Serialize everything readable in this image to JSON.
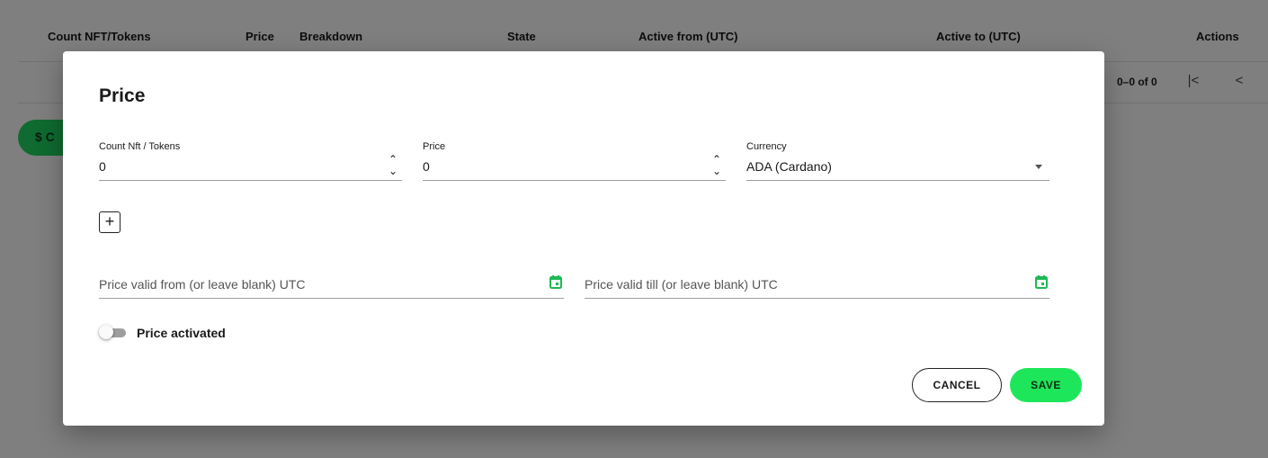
{
  "table": {
    "columns": [
      "Count NFT/Tokens",
      "Price",
      "Breakdown",
      "State",
      "Active from (UTC)",
      "Active to (UTC)",
      "Actions"
    ],
    "pagination": "0–0 of 0"
  },
  "background_button": {
    "icon": "dollar-icon",
    "label": "$ C"
  },
  "dialog": {
    "title": "Price",
    "count_field": {
      "label": "Count Nft / Tokens",
      "value": "0"
    },
    "price_field": {
      "label": "Price",
      "value": "0"
    },
    "currency_field": {
      "label": "Currency",
      "value": "ADA (Cardano)"
    },
    "add_button": "+",
    "valid_from": {
      "placeholder": "Price valid from (or leave blank) UTC"
    },
    "valid_till": {
      "placeholder": "Price valid till (or leave blank) UTC"
    },
    "toggle": {
      "label": "Price activated",
      "checked": false
    },
    "cancel_label": "CANCEL",
    "save_label": "SAVE"
  },
  "colors": {
    "accent_green": "#1ee65a",
    "calendar_green": "#1db954"
  }
}
